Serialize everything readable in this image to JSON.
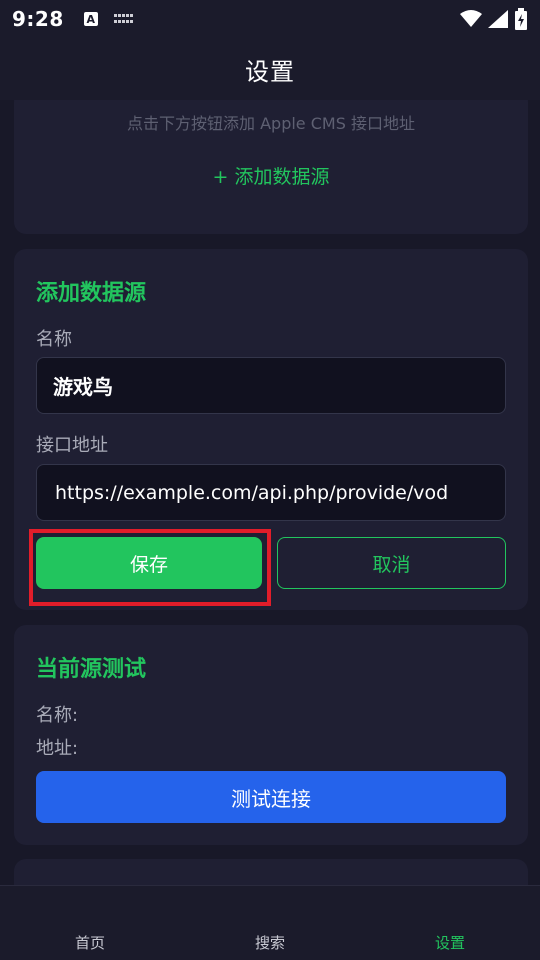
{
  "status_bar": {
    "time": "9:28",
    "a_icon_label": "A"
  },
  "header": {
    "title": "设置"
  },
  "source_list": {
    "hint": "点击下方按钮添加 Apple CMS 接口地址",
    "add_button": "+ 添加数据源"
  },
  "add_form": {
    "title": "添加数据源",
    "name_label": "名称",
    "name_value": "游戏鸟",
    "url_label": "接口地址",
    "url_value": "https://example.com/api.php/provide/vod",
    "save_button": "保存",
    "cancel_button": "取消"
  },
  "test_section": {
    "title": "当前源测试",
    "name_label": "名称:",
    "url_label": "地址:",
    "test_button": "测试连接"
  },
  "bottom_nav": {
    "items": [
      {
        "label": "首页"
      },
      {
        "label": "搜索"
      },
      {
        "label": "设置"
      }
    ],
    "active_color": "#22c55e"
  },
  "colors": {
    "accent_green": "#22c55e",
    "button_blue": "#2563eb",
    "highlight_red": "#e11d2a",
    "background": "#181828",
    "card": "#1f1f33"
  }
}
